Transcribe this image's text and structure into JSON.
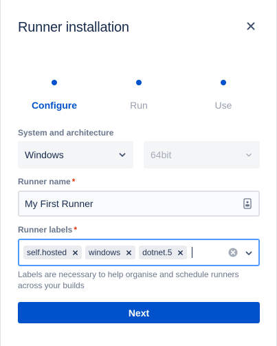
{
  "modal": {
    "title": "Runner installation"
  },
  "steps": [
    {
      "label": "Configure",
      "state": "active"
    },
    {
      "label": "Run",
      "state": "inactive"
    },
    {
      "label": "Use",
      "state": "inactive"
    }
  ],
  "system": {
    "label": "System and architecture",
    "os_value": "Windows",
    "arch_value": "64bit"
  },
  "runner_name": {
    "label": "Runner name",
    "required_mark": "*",
    "value": "My First Runner"
  },
  "runner_labels": {
    "label": "Runner labels",
    "required_mark": "*",
    "tags": [
      "self.hosted",
      "windows",
      "dotnet.5"
    ],
    "helper": "Labels are necessary to help organise and schedule runners across your builds"
  },
  "actions": {
    "next_label": "Next"
  },
  "colors": {
    "primary": "#0052cc",
    "focus_border": "#4c9aff",
    "required": "#de350b"
  }
}
